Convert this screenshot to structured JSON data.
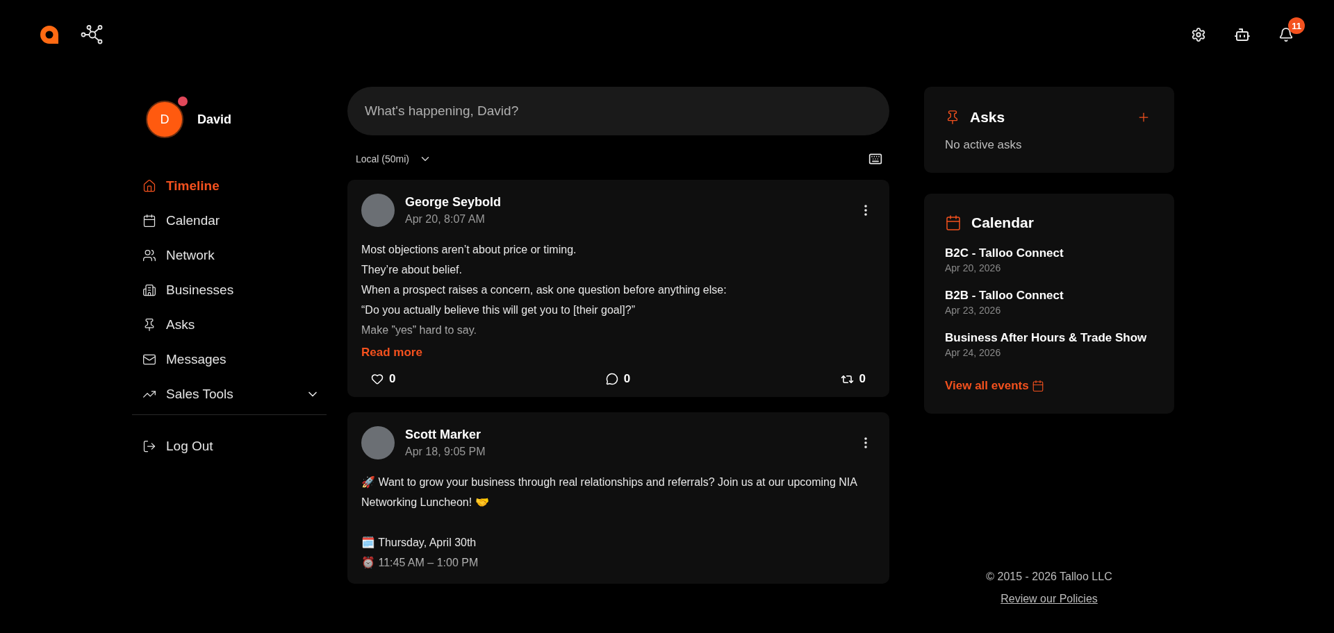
{
  "header": {
    "notifications_badge": "11"
  },
  "profile": {
    "initial": "D",
    "name": "David"
  },
  "nav": [
    {
      "label": "Timeline",
      "selected": true,
      "kind": "link"
    },
    {
      "label": "Calendar",
      "selected": false,
      "kind": "link"
    },
    {
      "label": "Network",
      "selected": false,
      "kind": "link"
    },
    {
      "label": "Businesses",
      "selected": false,
      "kind": "link"
    },
    {
      "label": "Asks",
      "selected": false,
      "kind": "link"
    },
    {
      "label": "Messages",
      "selected": false,
      "kind": "link"
    },
    {
      "label": "Sales Tools",
      "selected": false,
      "kind": "group",
      "expanded": false
    }
  ],
  "logout": {
    "label": "Log Out"
  },
  "composer": {
    "placeholder": "What's happening, David?"
  },
  "filter": {
    "value": "Local (50mi)"
  },
  "posts": [
    {
      "author": "George Seybold",
      "time": "Apr 20, 8:07 AM",
      "paragraphs": [
        [
          "Most objections aren’t about price or timing.",
          "They’re about belief.",
          "When a prospect raises a concern, ask one question before anything else:",
          "“Do you actually believe this will get you to [their goal]?”",
          "Make ”yes” hard to say."
        ]
      ],
      "read_more": "Read more",
      "likes": "0",
      "comments": "0",
      "reposts": "0"
    },
    {
      "author": "Scott Marker",
      "time": "Apr 18, 9:05 PM",
      "paragraphs": [
        [
          "🚀 Want to grow your business through real relationships and referrals? Join us at our upcoming NIA Networking Luncheon! 🤝"
        ],
        [
          "🗓️ Thursday, April 30th",
          "⏰ 11:45 AM – 1:00 PM"
        ]
      ]
    }
  ],
  "asks": {
    "title": "Asks",
    "empty": "No active asks"
  },
  "calendar": {
    "title": "Calendar",
    "events": [
      {
        "name": "B2C - Talloo Connect",
        "date": "Apr 20, 2026"
      },
      {
        "name": "B2B - Talloo Connect",
        "date": "Apr 23, 2026"
      },
      {
        "name": "Business After Hours & Trade Show",
        "date": "Apr 24, 2026"
      }
    ],
    "link": "View all events"
  },
  "footer": {
    "copyright": "© 2015 - 2026 Talloo LLC",
    "policies": "Review our Policies"
  }
}
